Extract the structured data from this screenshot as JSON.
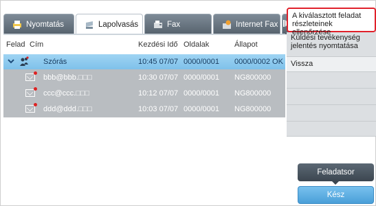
{
  "tabs": [
    {
      "label": "Nyomtatás",
      "icon": "printer-icon"
    },
    {
      "label": "Lapolvasás",
      "icon": "scanner-icon"
    },
    {
      "label": "Fax",
      "icon": "fax-icon"
    },
    {
      "label": "Internet Fax",
      "icon": "internet-fax-icon"
    },
    {
      "label": "",
      "icon": "tab-scroll-right-icon"
    }
  ],
  "columns": {
    "sender": "Felad",
    "address": "Cím",
    "start_time": "Kezdési Idő",
    "pages": "Oldalak",
    "status": "Állapot"
  },
  "rows": [
    {
      "address": "Szórás",
      "start_time": "10:45 07/07",
      "pages": "0000/0001",
      "status": "0000/0002 OK",
      "selected": true,
      "icon": "group-broadcast-icon"
    },
    {
      "address": "bbb@bbb.□□□",
      "start_time": "10:30 07/07",
      "pages": "0000/0001",
      "status": "NG800000",
      "icon": "email-icon"
    },
    {
      "address": "ccc@ccc.□□□",
      "start_time": "10:12 07/07",
      "pages": "0000/0001",
      "status": "NG800000",
      "icon": "email-icon"
    },
    {
      "address": "ddd@ddd.□□□",
      "start_time": "10:03 07/07",
      "pages": "0000/0001",
      "status": "NG800000",
      "icon": "email-icon"
    }
  ],
  "right_panel": {
    "check_details": "A kiválasztott feladat részleteinek ellenőrzése",
    "print_report": "Küldési tevékenység jelentés nyomtatása",
    "back": "Vissza"
  },
  "buttons": {
    "queue": "Feladatsor",
    "done": "Kész"
  },
  "colors": {
    "highlight_border": "#e0202a",
    "selected_row": "#8fcaef",
    "done_button": "#5aaee2"
  }
}
